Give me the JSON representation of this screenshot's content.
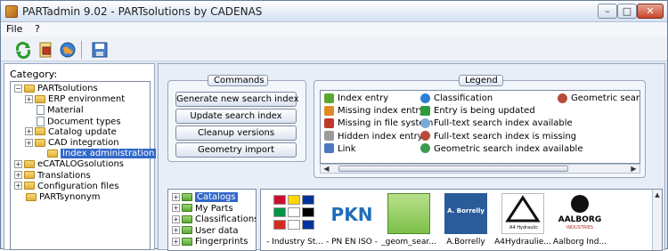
{
  "window": {
    "title": "PARTadmin 9.02 - PARTsolutions by CADENAS",
    "min_glyph": "–",
    "max_glyph": "□",
    "close_glyph": "✕"
  },
  "menu": {
    "file": "File",
    "help": "?"
  },
  "toolbar": {
    "icons": [
      "refresh-icon",
      "parts-icon",
      "globe-icon",
      "save-icon"
    ]
  },
  "left": {
    "category_label": "Category:",
    "tree": [
      {
        "label": "PARTsolutions",
        "icon": "folder",
        "level": 0,
        "expander": "−"
      },
      {
        "label": "ERP environment",
        "icon": "folder",
        "level": 1,
        "expander": "+"
      },
      {
        "label": "Material",
        "icon": "doc",
        "level": 1
      },
      {
        "label": "Document types",
        "icon": "doc",
        "level": 1
      },
      {
        "label": "Catalog update",
        "icon": "folder",
        "level": 1,
        "expander": "+"
      },
      {
        "label": "CAD integration",
        "icon": "folder",
        "level": 1,
        "expander": "+"
      },
      {
        "label": "Index administration",
        "icon": "folder",
        "level": 2,
        "selected": true
      },
      {
        "label": "eCATALOGsolutions",
        "icon": "folder",
        "level": 0,
        "expander": "+"
      },
      {
        "label": "Translations",
        "icon": "folder",
        "level": 0,
        "expander": "+"
      },
      {
        "label": "Configuration files",
        "icon": "folder",
        "level": 0,
        "expander": "+"
      },
      {
        "label": "PARTsynonym",
        "icon": "folder",
        "level": 0
      }
    ]
  },
  "commands": {
    "title": "Commands",
    "buttons": [
      "Generate new search index",
      "Update search index",
      "Cleanup versions",
      "Geometry import"
    ]
  },
  "legend": {
    "title": "Legend",
    "items": [
      {
        "label": "Index entry",
        "color": "#5aa832"
      },
      {
        "label": "Missing index entry",
        "color": "#e08a2a"
      },
      {
        "label": "Missing in file system",
        "color": "#c0392b"
      },
      {
        "label": "Hidden index entry",
        "color": "#9b9b9b"
      },
      {
        "label": "Link",
        "color": "#4a78c2"
      },
      {
        "label": "Classification",
        "color": "#2a7fd6"
      },
      {
        "label": "Entry is being updated",
        "color": "#2f9b3f"
      },
      {
        "label": "Full-text search index available",
        "color": "#7aa9d6"
      },
      {
        "label": "Full-text search index is missing",
        "color": "#b94a3a"
      },
      {
        "label": "Geometric search index available",
        "color": "#3c9b50"
      },
      {
        "label": "Geometric search",
        "color": "#b94a3a"
      }
    ]
  },
  "catalog_tree": {
    "items": [
      {
        "label": "Catalogs",
        "selected": true
      },
      {
        "label": "My Parts"
      },
      {
        "label": "Classifications"
      },
      {
        "label": "User data"
      },
      {
        "label": "Fingerprints"
      }
    ]
  },
  "thumbnails": [
    {
      "caption": "- Industry St...",
      "kind": "flags"
    },
    {
      "caption": "- PN EN ISO -",
      "kind": "pkn",
      "text": "PKN"
    },
    {
      "caption": "_geom_sear...",
      "kind": "folder"
    },
    {
      "caption": "A.Borrelly",
      "kind": "borrelly",
      "text": "A. Borrelly"
    },
    {
      "caption": "A4Hydraulie...",
      "kind": "a4",
      "text": "A4 Hydraulic"
    },
    {
      "caption": "Aalborg Ind...",
      "kind": "aalborg",
      "text": "AALBORG",
      "subtext": "INDUSTRIES"
    }
  ]
}
